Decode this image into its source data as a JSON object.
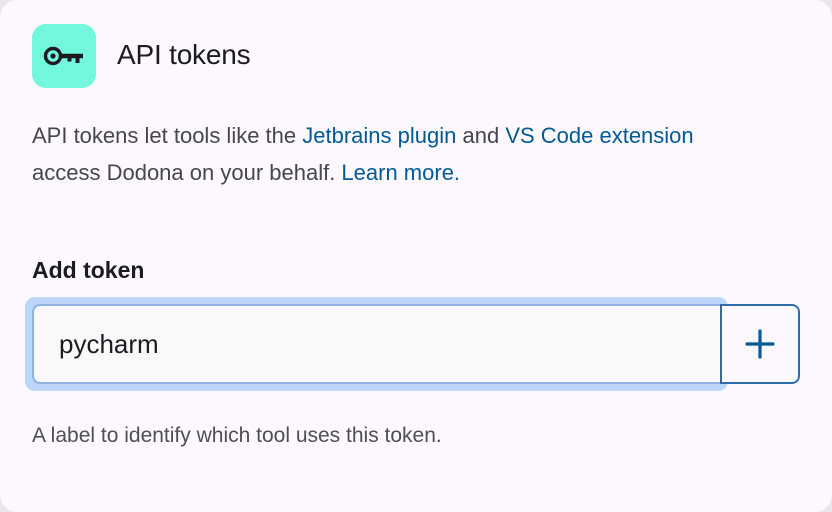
{
  "header": {
    "title": "API tokens",
    "icon": "key-icon",
    "icon_bg_color": "#73f7dd"
  },
  "description": {
    "text_before": "API tokens let tools like the ",
    "link_jetbrains": "Jetbrains plugin",
    "text_middle": " and ",
    "link_vscode": "VS Code extension",
    "text_after": " access Dodona on your behalf. ",
    "link_learn_more": "Learn more."
  },
  "form": {
    "label": "Add token",
    "input_value": "pycharm",
    "add_button_icon": "plus-icon",
    "helper_text": "A label to identify which tool uses this token."
  },
  "colors": {
    "link": "#005b95",
    "accent": "#2e6da6",
    "card_bg": "#fcf8fd"
  }
}
